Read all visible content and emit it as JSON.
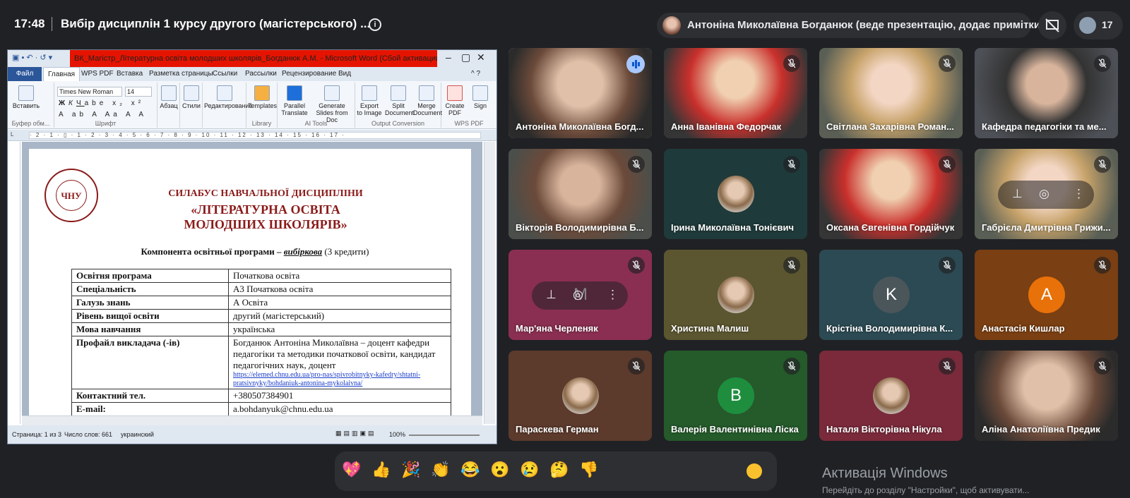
{
  "topbar": {
    "time": "17:48",
    "meeting_title": "Вибір дисциплін 1 курсу другого (магістерського) ...",
    "presenter_text": "Антоніна Миколаївна Богданюк (веде презентацію, додає примітки)",
    "participant_count": "17",
    "icons": [
      "info-icon",
      "no-present-icon",
      "people-icon"
    ]
  },
  "word": {
    "title": "ВК_Магістр_Літературна освіта молодших школярів_Богданюк А.М. - Microsoft Word (Сбой активации продукта)",
    "tabs": [
      "Файл",
      "Главная",
      "WPS PDF",
      "Вставка",
      "Разметка страницы",
      "Ссылки",
      "Рассылки",
      "Рецензирование",
      "Вид"
    ],
    "active_tab": "Главная",
    "font_name": "Times New Roman",
    "font_size": "14",
    "ribbon": {
      "paste": "Вставить",
      "clipboard_group": "Буфер обм...",
      "font_group": "Шрифт",
      "paragraph": "Абзац",
      "styles": "Стили",
      "editing": "Редактирование",
      "templates": "Templates",
      "library_group": "Library",
      "parallel_translate": "Parallel Translate",
      "generate_slides": "Generate Slides from Doc",
      "ai_tools_group": "AI Tools",
      "export_image": "Export to Image",
      "split_document": "Split Document",
      "merge_document": "Merge Document",
      "output_group": "Output Conversion",
      "create_pdf": "Create PDF",
      "sign": "Sign",
      "wps_pdf_group": "WPS PDF"
    },
    "ruler_text": "· 2 · 1 · ▯ · 1 · 2 · 3 · 4 · 5 · 6 · 7 · 8 · 9 · 10 · 11 · 12 · 13 · 14 · 15 · 16 · 17 ·",
    "document": {
      "logo_text": "ЧНУ",
      "syllabus_heading": "СИЛАБУС НАВЧАЛЬНОЇ ДИСЦИПЛІНИ",
      "course_title_1": "«ЛІТЕРАТУРНА ОСВІТА",
      "course_title_2": "МОЛОДШИХ ШКОЛЯРІВ»",
      "component_prefix": "Компонента освітньої програми – ",
      "component_type": "вибіркова",
      "component_credits": " (3 кредити)",
      "rows": [
        {
          "key": "Освітня програма",
          "value": "Початкова освіта"
        },
        {
          "key": "Спеціальність",
          "value": "А3 Початкова освіта"
        },
        {
          "key": "Галузь знань",
          "value": "А Освіта"
        },
        {
          "key": "Рівень вищої освіти",
          "value": "другий (магістерський)"
        },
        {
          "key": "Мова навчання",
          "value": "українська"
        },
        {
          "key": "Профайл викладача (-ів)",
          "value": "Богданюк Антоніна Миколаївна – доцент кафедри педагогіки та методики початкової освіти, кандидат педагогічних наук, доцент",
          "link": "https://elemed.chnu.edu.ua/pro-nas/spivrobitnyky-kafedry/shtatni-pratsivnyky/bohdaniuk-antonina-mykolaivna/"
        },
        {
          "key": "Контактний тел.",
          "value": "+380507384901"
        },
        {
          "key": "E-mail:",
          "value": "a.bohdanyuk@chnu.edu.ua"
        }
      ]
    },
    "status": {
      "page": "Страница: 1 из 3",
      "words": "Число слов: 661",
      "language": "украинский",
      "zoom": "100%"
    }
  },
  "participants": [
    {
      "name": "Антоніна Миколаївна Богд...",
      "speaking": true
    },
    {
      "name": "Анна Іванівна Федорчак",
      "muted": true
    },
    {
      "name": "Світлана Захарівна Роман...",
      "muted": true
    },
    {
      "name": "Кафедра педагогіки та ме...",
      "muted": true
    },
    {
      "name": "Вікторія Володимирівна Б...",
      "muted": true
    },
    {
      "name": "Ірина Миколаївна Тонієвич",
      "muted": true
    },
    {
      "name": "Оксана Євгенівна Гордійчук",
      "muted": true
    },
    {
      "name": "Габрієла Дмитрівна Грижи...",
      "muted": true
    },
    {
      "name": "Мар'яна Черленяк",
      "muted": true,
      "initial": "M"
    },
    {
      "name": "Христина Малиш",
      "muted": true
    },
    {
      "name": "Крістіна Володимирівна К...",
      "muted": true,
      "initial": "K"
    },
    {
      "name": "Анастасія Кишлар",
      "muted": true,
      "initial": "A"
    },
    {
      "name": "Параскева Герман",
      "muted": true
    },
    {
      "name": "Валерія Валентинівна Ліска",
      "muted": true,
      "initial": "B"
    },
    {
      "name": "Наталя Вікторівна Нікула",
      "muted": true
    },
    {
      "name": "Аліна Анатоліївна Предик",
      "muted": true
    }
  ],
  "reactions": [
    "💖",
    "👍",
    "🎉",
    "👏",
    "😂",
    "😮",
    "😢",
    "🤔",
    "👎"
  ],
  "windows_activation": {
    "title": "Активація Windows",
    "subtitle": "Перейдіть до розділу \"Настройки\", щоб активувати..."
  },
  "colors": {
    "background": "#202124",
    "tile": "#3c4043",
    "accent": "#a8c7fa",
    "word_title_red": "#e51400",
    "syllabus_red": "#8b1a1a"
  }
}
